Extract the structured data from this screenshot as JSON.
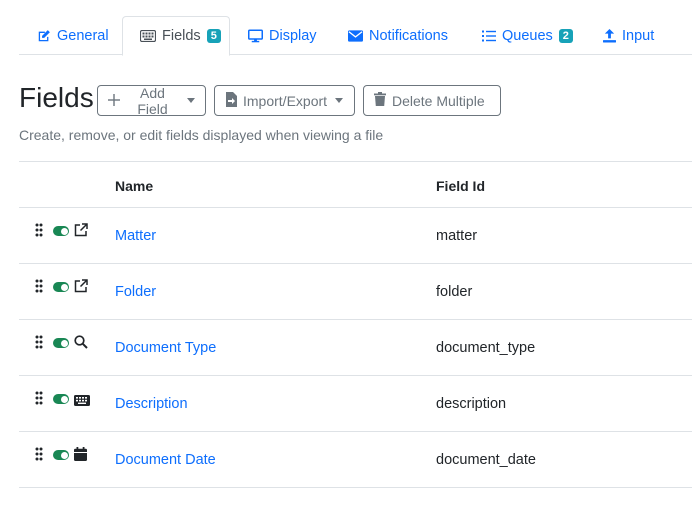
{
  "tabs": [
    {
      "label": "General",
      "icon": "edit-icon"
    },
    {
      "label": "Fields",
      "icon": "keyboard-icon",
      "badge": "5",
      "active": true
    },
    {
      "label": "Display",
      "icon": "monitor-icon"
    },
    {
      "label": "Notifications",
      "icon": "envelope-icon"
    },
    {
      "label": "Queues",
      "icon": "list-icon",
      "badge": "2"
    },
    {
      "label": "Input",
      "icon": "upload-icon"
    }
  ],
  "header": {
    "title": "Fields",
    "add_field": "Add Field",
    "import_export": "Import/Export",
    "delete_multiple": "Delete Multiple",
    "subtitle": "Create, remove, or edit fields displayed when viewing a file"
  },
  "table": {
    "columns": [
      "Name",
      "Field Id"
    ],
    "rows": [
      {
        "name": "Matter",
        "field_id": "matter",
        "icon": "external-link-icon"
      },
      {
        "name": "Folder",
        "field_id": "folder",
        "icon": "external-link-icon"
      },
      {
        "name": "Document Type",
        "field_id": "document_type",
        "icon": "search-icon"
      },
      {
        "name": "Description",
        "field_id": "description",
        "icon": "keyboard-icon"
      },
      {
        "name": "Document Date",
        "field_id": "document_date",
        "icon": "calendar-icon"
      }
    ]
  },
  "colors": {
    "link": "#0d6efd",
    "toggle_on": "#198754",
    "badge": "#17a2b8"
  }
}
